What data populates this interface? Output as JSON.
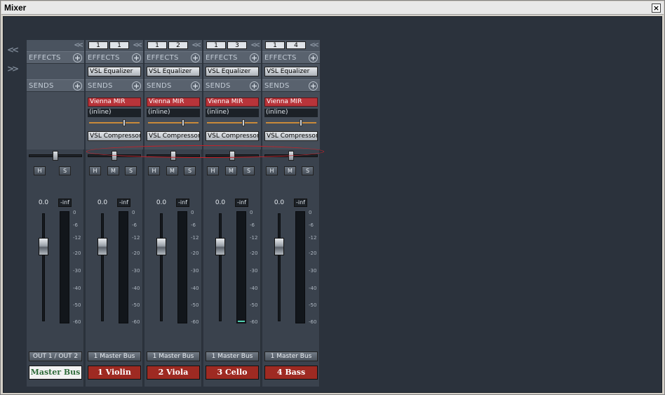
{
  "window": {
    "title": "Mixer",
    "close_glyph": "×"
  },
  "nav": {
    "collapse_glyph": "<<",
    "expand_glyph": ">>"
  },
  "labels": {
    "effects": "EFFECTS",
    "sends": "SENDS",
    "mute": "M",
    "solo": "S",
    "listen": "H"
  },
  "master": {
    "volume": "0.0",
    "peak": "-inf",
    "output": "OUT 1 / OUT 2",
    "name": "Master Bus"
  },
  "channels": [
    {
      "nums": [
        "1",
        "1"
      ],
      "effect": "VSL Equalizer",
      "send": "Vienna MIR",
      "send_mode": "(inline)",
      "insert": "VSL Compressor",
      "volume": "0.0",
      "peak": "-inf",
      "output": "1 Master Bus",
      "name": "1 Violin"
    },
    {
      "nums": [
        "1",
        "2"
      ],
      "effect": "VSL Equalizer",
      "send": "Vienna MIR",
      "send_mode": "(inline)",
      "insert": "VSL Compressor",
      "volume": "0.0",
      "peak": "-inf",
      "output": "1 Master Bus",
      "name": "2 Viola"
    },
    {
      "nums": [
        "1",
        "3"
      ],
      "effect": "VSL Equalizer",
      "send": "Vienna MIR",
      "send_mode": "(inline)",
      "insert": "VSL Compressor",
      "volume": "0.0",
      "peak": "-inf",
      "output": "1 Master Bus",
      "name": "3 Cello"
    },
    {
      "nums": [
        "1",
        "4"
      ],
      "effect": "VSL Equalizer",
      "send": "Vienna MIR",
      "send_mode": "(inline)",
      "insert": "VSL Compressor",
      "volume": "0.0",
      "peak": "-inf",
      "output": "1 Master Bus",
      "name": "4 Bass"
    }
  ],
  "meter_scale": [
    "0",
    "-6",
    "-12",
    "-20",
    "-30",
    "-40",
    "-50",
    "-60"
  ],
  "colors": {
    "canvas": "#2b323c",
    "channel_name": "#9e2a22",
    "send_active": "#b8343a",
    "highlight": "#c3222a",
    "meter_level": "#4fd0b0"
  }
}
